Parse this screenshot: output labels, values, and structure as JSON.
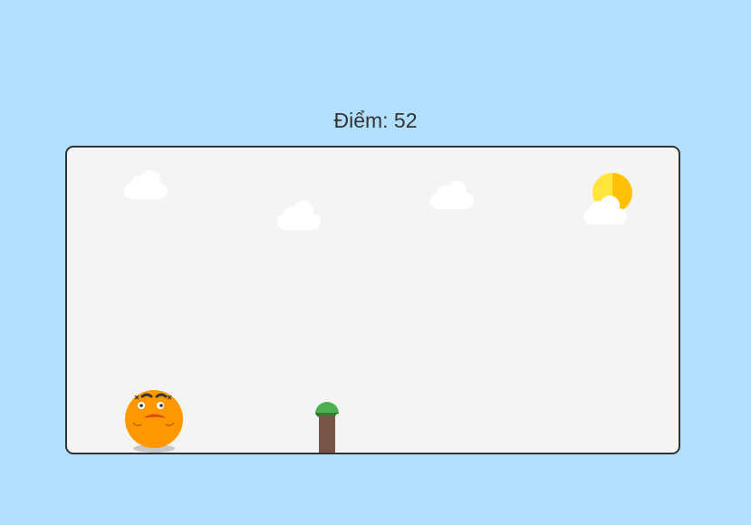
{
  "score": {
    "label": "Điểm:",
    "value": "52",
    "text": "Điểm: 52"
  },
  "colors": {
    "sky": "#b3dfff",
    "game_background": "#f4f4f4",
    "border": "#333333",
    "cloud": "#ffffff",
    "sun_light": "#ffe53b",
    "sun_dark": "#ffc107",
    "player_body": "#ff9800",
    "player_mouth": "#e64a19",
    "obstacle_trunk": "#795548",
    "obstacle_top": "#4caf50"
  },
  "icons": {
    "player": "orange-ball-face-icon",
    "obstacle": "tree-stump-icon",
    "sun": "sun-icon",
    "cloud": "cloud-icon"
  }
}
